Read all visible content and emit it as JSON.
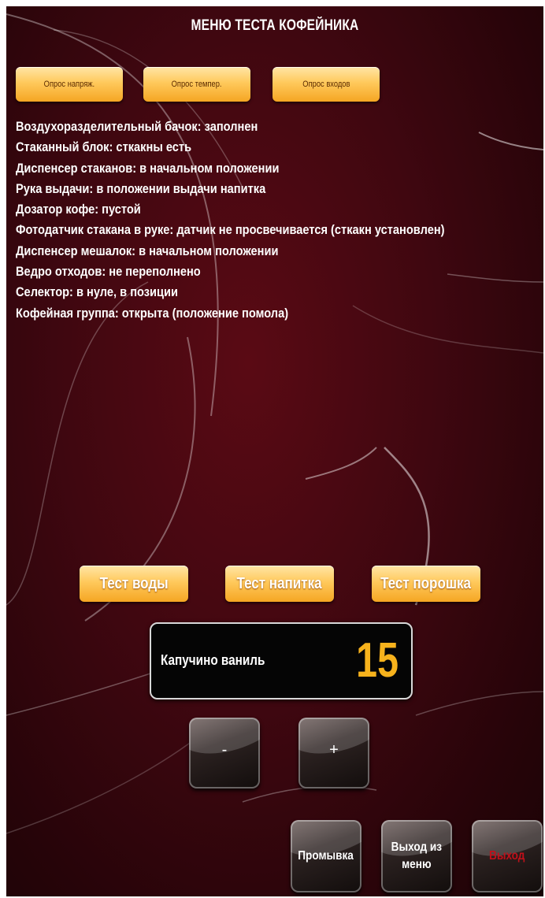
{
  "header": {
    "title": "МЕНЮ ТЕСТА КОФЕЙНИКА"
  },
  "poll_buttons": [
    {
      "label": "Опрос напряж."
    },
    {
      "label": "Опрос темпер."
    },
    {
      "label": "Опрос входов"
    }
  ],
  "status_lines": [
    "Воздухоразделительный бачок: заполнен",
    "Стаканный блок: сткакны есть",
    "Диспенсер стаканов: в начальном положении",
    "Рука выдачи: в положении выдачи напитка",
    "Дозатор кофе: пустой",
    "Фотодатчик стакана в руке: датчик не просвечивается (сткакн установлен)",
    "Диспенсер мешалок: в начальном положении",
    "Ведро отходов: не переполнено",
    "Селектор: в нуле, в позиции",
    "Кофейная группа: открыта (положение помола)"
  ],
  "test_buttons": [
    {
      "label": "Тест воды"
    },
    {
      "label": "Тест напитка"
    },
    {
      "label": "Тест порошка"
    }
  ],
  "display": {
    "drink_name": "Капучино ваниль",
    "number": "15"
  },
  "stepper": {
    "minus_label": "-",
    "plus_label": "+"
  },
  "bottom_buttons": {
    "flush_label": "Промывка",
    "exit_menu_label": "Выход из\nменю",
    "exit_label": "Выход"
  },
  "colors": {
    "background": "#3f0710",
    "button_orange": "#ffc95c",
    "number_yellow": "#f7b21c",
    "exit_text_red": "#c0101a"
  }
}
